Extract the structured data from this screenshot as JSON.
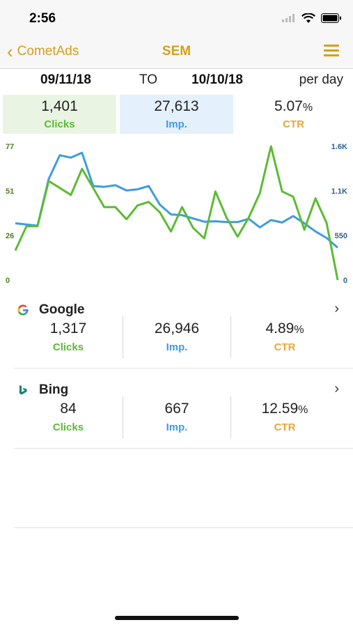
{
  "status_bar": {
    "time": "2:56"
  },
  "nav": {
    "back_label": "CometAds",
    "title": "SEM"
  },
  "date_range": {
    "from": "09/11/18",
    "separator": "TO",
    "to": "10/10/18",
    "granularity": "per day"
  },
  "totals": {
    "clicks": {
      "value": "1,401",
      "label": "Clicks"
    },
    "impressions": {
      "value": "27,613",
      "label": "Imp."
    },
    "ctr": {
      "value": "5.07",
      "unit": "%",
      "label": "CTR"
    }
  },
  "colors": {
    "accent": "#d6a017",
    "clicks": "#5bbb33",
    "impressions": "#3f9be0",
    "ctr": "#e9a63a"
  },
  "chart_data": {
    "type": "line",
    "left_axis": {
      "ticks": [
        "77",
        "51",
        "26",
        "0"
      ],
      "ylim": [
        0,
        77
      ],
      "color": "#4f7c23"
    },
    "right_axis": {
      "ticks": [
        "1.6K",
        "1.1K",
        "550",
        "0"
      ],
      "ylim": [
        0,
        1650
      ],
      "color": "#2e5f8f"
    },
    "grid": false,
    "series": [
      {
        "axis": "left",
        "color": "#5bbb33",
        "values": [
          17,
          31,
          31,
          57,
          53,
          49,
          64,
          53,
          42,
          42,
          35,
          43,
          45,
          39,
          28,
          42,
          30,
          24,
          51,
          36,
          25,
          36,
          50,
          77,
          51,
          48,
          29,
          47,
          33,
          0
        ]
      },
      {
        "axis": "right",
        "color": "#3f9be0",
        "values": [
          700,
          685,
          670,
          1245,
          1540,
          1510,
          1570,
          1160,
          1150,
          1170,
          1105,
          1120,
          1160,
          930,
          810,
          800,
          760,
          720,
          725,
          715,
          715,
          755,
          650,
          740,
          710,
          790,
          700,
          600,
          520,
          400
        ]
      }
    ]
  },
  "sources": [
    {
      "name": "Google",
      "logo": "google-logo",
      "clicks": "1,317",
      "clicks_label": "Clicks",
      "impressions": "26,946",
      "impressions_label": "Imp.",
      "ctr": "4.89",
      "ctr_unit": "%",
      "ctr_label": "CTR"
    },
    {
      "name": "Bing",
      "logo": "bing-logo",
      "clicks": "84",
      "clicks_label": "Clicks",
      "impressions": "667",
      "impressions_label": "Imp.",
      "ctr": "12.59",
      "ctr_unit": "%",
      "ctr_label": "CTR"
    }
  ],
  "icons": [
    "signal-icon",
    "wifi-icon",
    "battery-icon",
    "back-chevron-icon",
    "menu-icon",
    "chevron-right-icon"
  ]
}
